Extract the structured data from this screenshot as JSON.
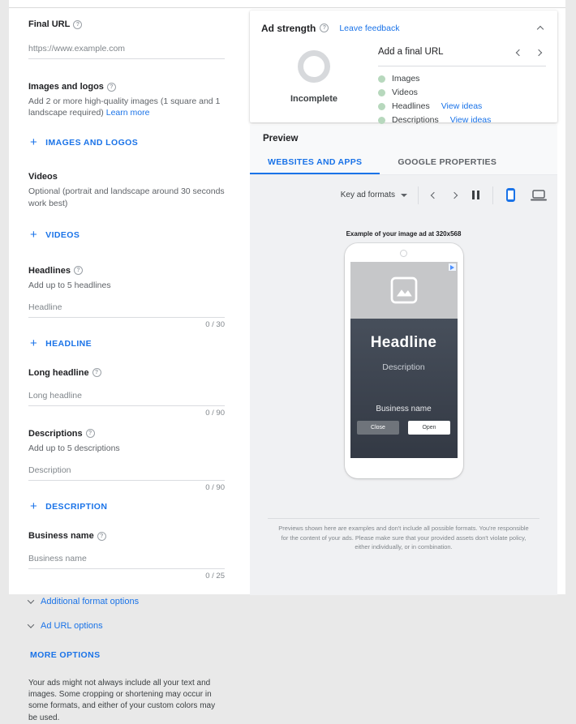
{
  "form": {
    "final_url": {
      "label": "Final URL",
      "placeholder": "https://www.example.com"
    },
    "images": {
      "label": "Images and logos",
      "description": "Add 2 or more high-quality images (1 square and 1 landscape required)",
      "link": "Learn more",
      "button": "IMAGES AND LOGOS"
    },
    "videos": {
      "label": "Videos",
      "description": "Optional (portrait and landscape around 30 seconds work best)",
      "button": "VIDEOS"
    },
    "headlines": {
      "label": "Headlines",
      "description": "Add up to 5 headlines",
      "placeholder": "Headline",
      "counter": "0 / 30",
      "button": "HEADLINE"
    },
    "long_headline": {
      "label": "Long headline",
      "placeholder": "Long headline",
      "counter": "0 / 90"
    },
    "descriptions": {
      "label": "Descriptions",
      "description": "Add up to 5 descriptions",
      "placeholder": "Description",
      "counter": "0 / 90",
      "button": "DESCRIPTION"
    },
    "business_name": {
      "label": "Business name",
      "placeholder": "Business name",
      "counter": "0 / 25"
    },
    "additional_format_options": "Additional format options",
    "ad_url_options": "Ad URL options",
    "more_options": "MORE OPTIONS",
    "disclaimer": "Your ads might not always include all your text and images. Some cropping or shortening may occur in some formats, and either of your custom colors may be used."
  },
  "ad_strength": {
    "title": "Ad strength",
    "feedback_link": "Leave feedback",
    "status": "Incomplete",
    "action": "Add a final URL",
    "items": [
      {
        "label": "Images",
        "link": ""
      },
      {
        "label": "Videos",
        "link": ""
      },
      {
        "label": "Headlines",
        "link": "View ideas"
      },
      {
        "label": "Descriptions",
        "link": "View ideas"
      }
    ]
  },
  "preview": {
    "title": "Preview",
    "tabs": [
      "WEBSITES AND APPS",
      "GOOGLE PROPERTIES"
    ],
    "format_selector": "Key ad formats",
    "caption": "Example of your image ad at 320x568",
    "ad": {
      "headline": "Headline",
      "description": "Description",
      "business_name": "Business name",
      "close_button": "Close",
      "open_button": "Open"
    },
    "disclaimer": "Previews shown here are examples and don't include all possible formats. You're responsible for the content of your ads. Please make sure that your provided assets don't violate policy, either individually, or in combination."
  },
  "colors": {
    "accent": "#1a73e8",
    "green_dot": "#b7d8bd",
    "ring_gray": "#d7d9dc",
    "ad_panel_dark": "#3b424d"
  }
}
